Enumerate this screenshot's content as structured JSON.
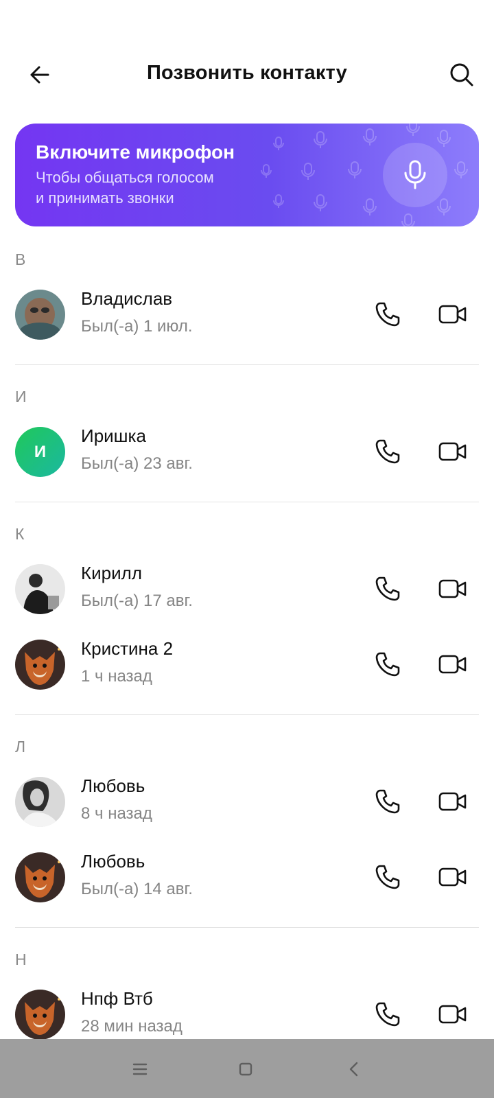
{
  "header": {
    "title": "Позвонить контакту",
    "back_icon": "arrow-left-icon",
    "search_icon": "search-icon"
  },
  "mic_banner": {
    "title": "Включите микрофон",
    "subtitle_line1": "Чтобы общаться голосом",
    "subtitle_line2": "и принимать звонки",
    "icon": "microphone-icon",
    "colors": {
      "start": "#7436f2",
      "end": "#8d7dfb"
    }
  },
  "sections": [
    {
      "letter": "В",
      "contacts": [
        {
          "name": "Владислав",
          "status": "Был(-а) 1 июл.",
          "avatar": "photo"
        }
      ]
    },
    {
      "letter": "И",
      "contacts": [
        {
          "name": "Иришка",
          "status": "Был(-а) 23 авг.",
          "avatar_letter": "И"
        }
      ]
    },
    {
      "letter": "К",
      "contacts": [
        {
          "name": "Кирилл",
          "status": "Был(-а) 17 авг.",
          "avatar": "photo"
        },
        {
          "name": "Кристина 2",
          "status": "1 ч назад",
          "avatar": "photo"
        }
      ]
    },
    {
      "letter": "Л",
      "contacts": [
        {
          "name": "Любовь",
          "status": "8 ч назад",
          "avatar": "photo"
        },
        {
          "name": "Любовь",
          "status": "Был(-а) 14 авг.",
          "avatar": "photo"
        }
      ]
    },
    {
      "letter": "Н",
      "contacts": [
        {
          "name": "Нпф Втб",
          "status": "28 мин назад",
          "avatar": "photo"
        }
      ]
    }
  ],
  "contact_actions": {
    "call_icon": "phone-icon",
    "video_icon": "video-camera-icon"
  },
  "navbar": {
    "icons": [
      "menu-icon",
      "home-square-icon",
      "back-chevron-icon"
    ]
  }
}
